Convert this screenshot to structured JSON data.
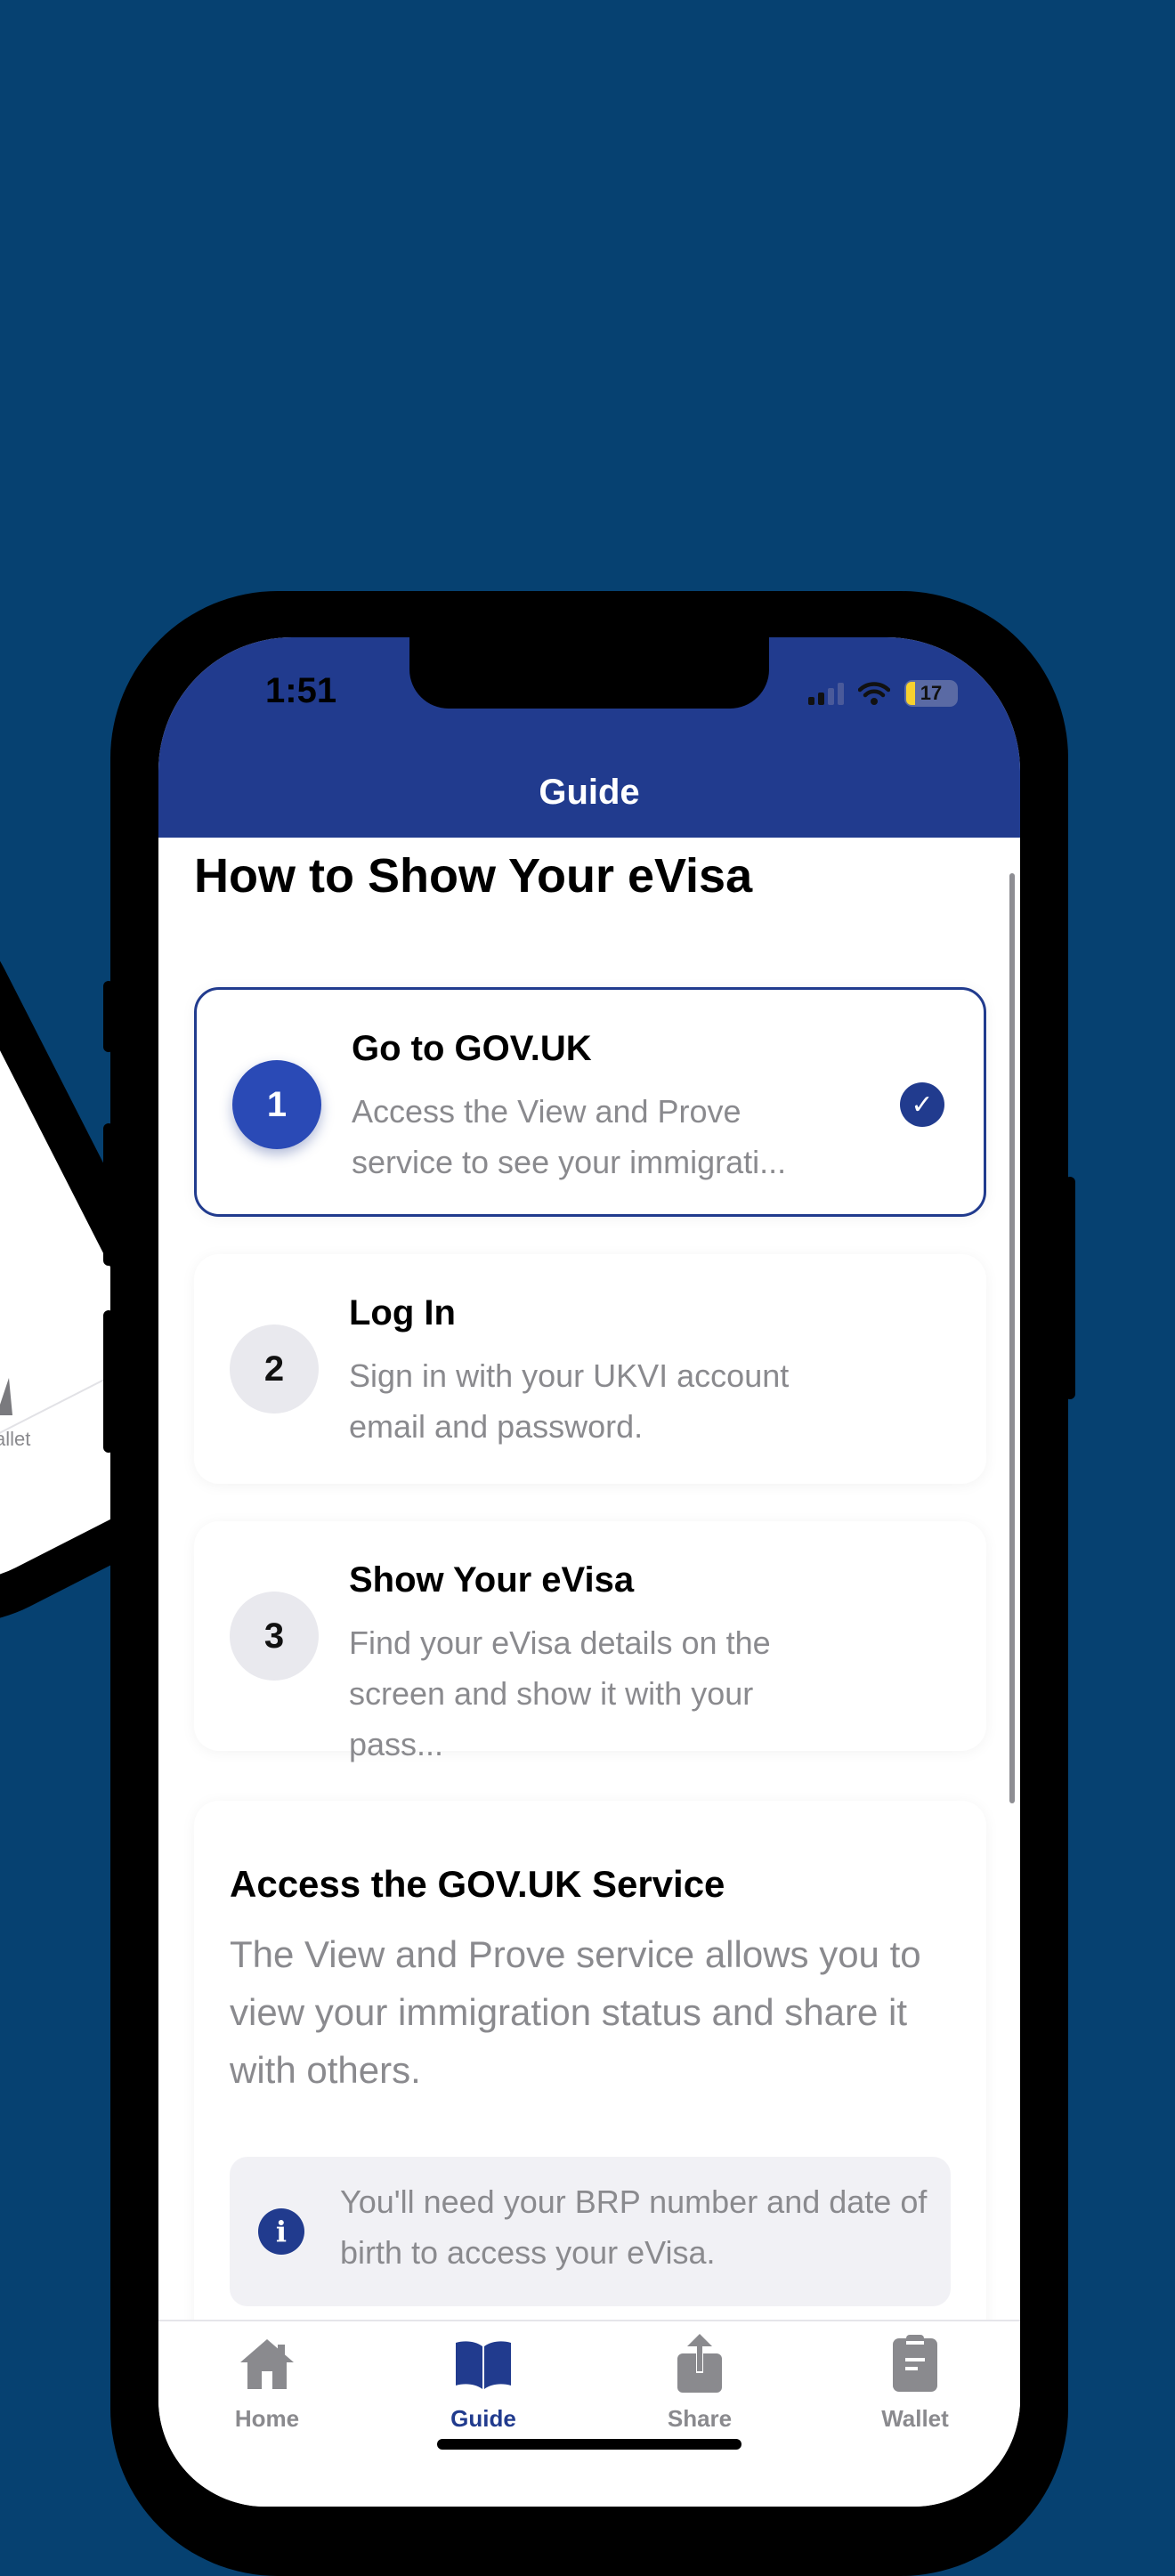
{
  "background_phone": {
    "tab_label": "allet"
  },
  "status_bar": {
    "time": "1:51",
    "battery": "17"
  },
  "header": {
    "title": "Guide"
  },
  "page": {
    "heading": "How to Show Your eVisa"
  },
  "steps": [
    {
      "number": "1",
      "title": "Go to GOV.UK",
      "description": "Access the View and Prove service to see your immigrati...",
      "completed": true
    },
    {
      "number": "2",
      "title": "Log In",
      "description": "Sign in with your UKVI account email and password.",
      "completed": false
    },
    {
      "number": "3",
      "title": "Show Your eVisa",
      "description": "Find your eVisa details on the screen and show it with your pass...",
      "completed": false
    }
  ],
  "info": {
    "title": "Access the GOV.UK Service",
    "body": "The View and Prove service allows you to view your immigration status and share it with others.",
    "notice": "You'll need your BRP number and date of birth to access your eVisa."
  },
  "tabs": [
    {
      "label": "Home",
      "icon": "home-icon",
      "active": false
    },
    {
      "label": "Guide",
      "icon": "book-icon",
      "active": true
    },
    {
      "label": "Share",
      "icon": "share-icon",
      "active": false
    },
    {
      "label": "Wallet",
      "icon": "wallet-icon",
      "active": false
    }
  ],
  "colors": {
    "background": "#064171",
    "primary": "#213b8e",
    "muted_text": "#8a8a8e"
  }
}
